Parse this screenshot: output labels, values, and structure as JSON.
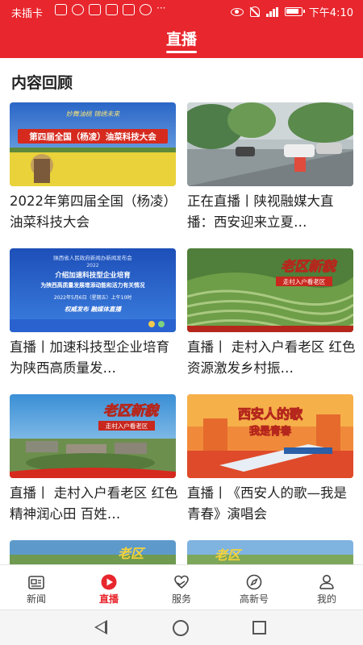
{
  "status_bar": {
    "carrier": "未插卡",
    "time": "下午4:10"
  },
  "header": {
    "title": "直播"
  },
  "section": {
    "title": "内容回顾"
  },
  "cards": [
    {
      "caption": "2022年第四届全国（杨凌）油菜科技大会",
      "thumb_text": "第四届全国（杨凌）油菜科技大会",
      "thumb_subtext": "妙舞油桃 锦绣未来"
    },
    {
      "caption": "正在直播丨陕视融媒大直播：西安迎来立夏…",
      "thumb_text": "",
      "thumb_subtext": ""
    },
    {
      "caption": "直播丨加速科技型企业培育 为陕西高质量发…",
      "thumb_text": "介绍加速科技型企业培育",
      "thumb_subtext": "为陕西高质量发展增添动能和活力有关情况",
      "thumb_line1": "陕西省人民政府新闻办新闻发布会",
      "thumb_line2": "2022",
      "thumb_line3": "2022年5月6日（星期五）上午10时",
      "thumb_banner": "权威发布 融媒体直播"
    },
    {
      "caption": "直播丨 走村入户看老区 红色资源激发乡村振…",
      "thumb_text": "老区新貌",
      "thumb_subtext": "走村入户看老区"
    },
    {
      "caption": "直播丨 走村入户看老区 红色精神润心田 百姓…",
      "thumb_text": "老区新貌",
      "thumb_subtext": "走村入户看老区"
    },
    {
      "caption": "直播丨《西安人的歌—我是青春》演唱会",
      "thumb_text": "西安人的歌",
      "thumb_subtext": "我是青春"
    },
    {
      "caption": "",
      "thumb_text": "老区",
      "thumb_subtext": ""
    },
    {
      "caption": "",
      "thumb_text": "老区",
      "thumb_subtext": ""
    }
  ],
  "bottom_nav": [
    {
      "label": "新闻",
      "icon": "news-icon"
    },
    {
      "label": "直播",
      "icon": "live-play-icon",
      "active": true
    },
    {
      "label": "服务",
      "icon": "service-heart-icon"
    },
    {
      "label": "高新号",
      "icon": "compass-icon"
    },
    {
      "label": "我的",
      "icon": "user-icon"
    }
  ],
  "colors": {
    "brand_red": "#e8262d",
    "text": "#222222",
    "nav_inactive": "#444444"
  }
}
